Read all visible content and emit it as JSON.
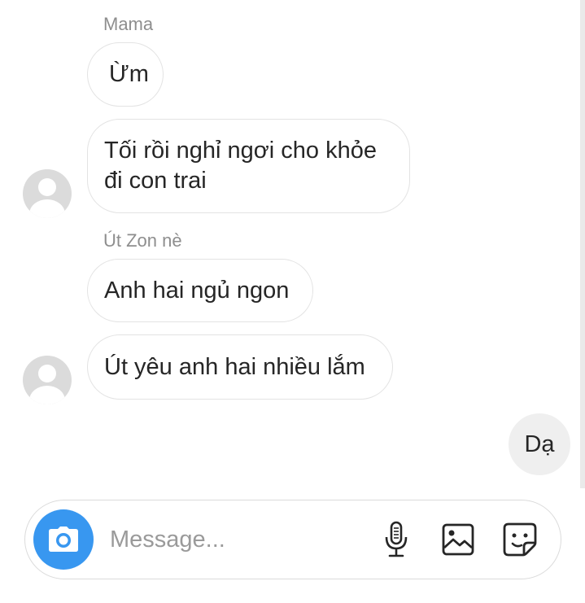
{
  "conversation": {
    "messages": [
      {
        "sender_label": "Mama",
        "text": "Ừm"
      },
      {
        "text": "Tối rồi nghỉ ngơi cho khỏe\nđi con trai"
      },
      {
        "sender_label": "Út Zon nè",
        "text": "Anh hai ngủ ngon"
      },
      {
        "text": "Út yêu anh hai nhiều lắm"
      },
      {
        "text": "Dạ"
      }
    ]
  },
  "composer": {
    "placeholder": "Message...",
    "value": "",
    "icons": {
      "camera": "camera-icon",
      "mic": "microphone-icon",
      "gallery": "image-icon",
      "sticker": "sticker-icon"
    },
    "accent_color": "#3897f0"
  }
}
